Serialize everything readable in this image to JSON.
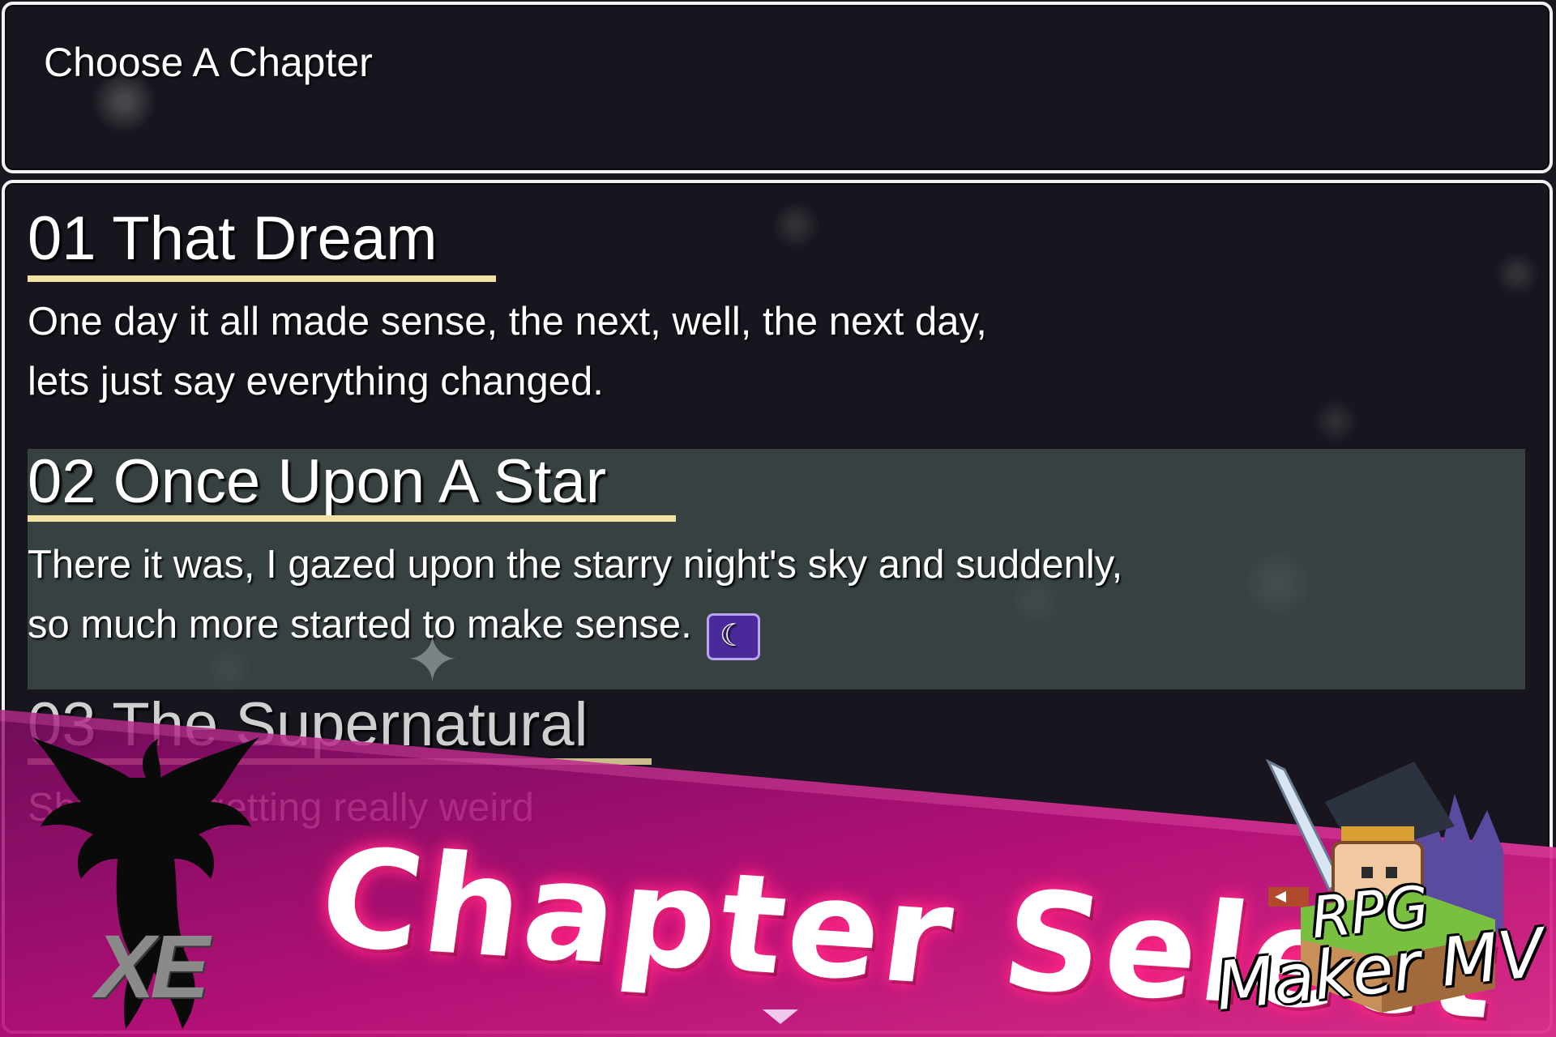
{
  "help": {
    "text": "Choose A Chapter"
  },
  "chapters": [
    {
      "title": "01 That Dream",
      "description_line1": "One day it all made sense, the next, well, the next day,",
      "description_line2": "lets just say everything changed."
    },
    {
      "title": "02 Once Upon A Star",
      "description_line1": "There it was, I gazed upon the starry night's sky and suddenly,",
      "description_line2": "so much more started to make sense.",
      "icon": "spiral-moon-icon",
      "selected": true
    },
    {
      "title": "03 The Supernatural",
      "description_line1": "Shit's are getting really weird"
    }
  ],
  "banner": {
    "title": "Chapter Select",
    "left_logo_text": "XE",
    "right_logo_line1": "RPG",
    "right_logo_line2": "Maker MV"
  },
  "colors": {
    "underline": "#f2e2a6",
    "highlight": "#4a5c58",
    "banner_magenta": "#c8107a",
    "window_border": "#f2f2f2"
  }
}
